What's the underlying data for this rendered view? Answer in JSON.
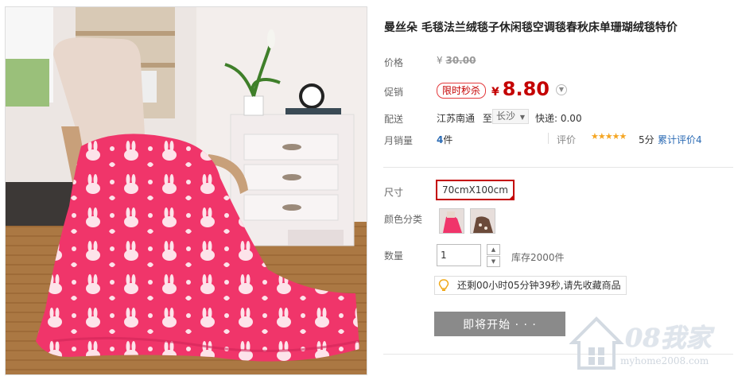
{
  "product": {
    "title": "曼丝朵 毛毯法兰绒毯子休闲毯空调毯春秋床单珊瑚绒毯特价",
    "price_label": "价格",
    "original_currency": "¥",
    "original_price": "30.00",
    "promo_label": "促销",
    "promo_badge": "限时秒杀",
    "sale_currency": "¥",
    "sale_price": "8.80",
    "shipping_label": "配送",
    "ship_from": "江苏南通",
    "ship_to_word": "至",
    "ship_to": "长沙",
    "ship_fee": "快递: 0.00",
    "sales_label": "月销量",
    "sales_count": "4",
    "sales_unit": "件",
    "rating_label": "评价",
    "stars": "★★★★★",
    "rating_score": "5分",
    "review_link": "累计评价4",
    "size_label": "尺寸",
    "size_option": "70cmX100cm",
    "color_label": "颜色分类",
    "qty_label": "数量",
    "qty_value": "1",
    "stock": "库存2000件",
    "countdown": "还剩00小时05分钟39秒,请先收藏商品",
    "buy_button": "即将开始 · · ·"
  },
  "icons": {
    "more": "chevron-down-icon",
    "qty_up": "caret-up-icon",
    "qty_down": "caret-down-icon",
    "notice": "lightbulb-icon"
  },
  "watermark": {
    "brand": "08我家",
    "site": "myhome2008.com"
  },
  "colors": {
    "price_red": "#c40000",
    "link_blue": "#2a6ab4",
    "star_gold": "#f5a623",
    "button_gray": "#8a8a8a",
    "blanket_pink": "#f0356a"
  }
}
